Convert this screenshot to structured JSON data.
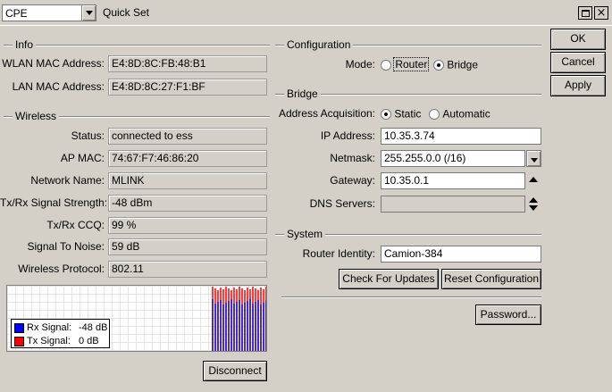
{
  "window": {
    "mode_selector": "CPE",
    "title": "Quick Set",
    "maximize_glyph": "",
    "close_glyph": "×"
  },
  "info": {
    "title": "Info",
    "wlan_mac_label": "WLAN MAC Address:",
    "wlan_mac_value": "E4:8D:8C:FB:48:B1",
    "lan_mac_label": "LAN MAC Address:",
    "lan_mac_value": "E4:8D:8C:27:F1:BF"
  },
  "wireless": {
    "title": "Wireless",
    "rows": [
      {
        "label": "Status:",
        "value": "connected to ess"
      },
      {
        "label": "AP MAC:",
        "value": "74:67:F7:46:86:20"
      },
      {
        "label": "Network Name:",
        "value": "MLINK"
      },
      {
        "label": "Tx/Rx Signal Strength:",
        "value": "-48 dBm"
      },
      {
        "label": "Tx/Rx CCQ:",
        "value": "99 %"
      },
      {
        "label": "Signal To Noise:",
        "value": "59 dB"
      },
      {
        "label": "Wireless Protocol:",
        "value": "802.11"
      }
    ]
  },
  "graph": {
    "legend": [
      {
        "name": "Rx Signal:",
        "value": "-48 dB",
        "color": "#0000ff"
      },
      {
        "name": "Tx Signal:",
        "value": "0 dB",
        "color": "#ff0000"
      }
    ]
  },
  "disconnect_label": "Disconnect",
  "configuration": {
    "title": "Configuration",
    "mode_label": "Mode:",
    "mode_options": [
      "Router",
      "Bridge"
    ],
    "mode_selected": "Bridge"
  },
  "bridge": {
    "title": "Bridge",
    "acq_label": "Address Acquisition:",
    "acq_options": [
      "Static",
      "Automatic"
    ],
    "acq_selected": "Static",
    "ip_label": "IP Address:",
    "ip_value": "10.35.3.74",
    "netmask_label": "Netmask:",
    "netmask_value": "255.255.0.0 (/16)",
    "gateway_label": "Gateway:",
    "gateway_value": "10.35.0.1",
    "dns_label": "DNS Servers:",
    "dns_value": ""
  },
  "system": {
    "title": "System",
    "identity_label": "Router Identity:",
    "identity_value": "Camion-384",
    "check_updates_label": "Check For Updates",
    "reset_config_label": "Reset Configuration"
  },
  "password_label": "Password...",
  "actions": {
    "ok": "OK",
    "cancel": "Cancel",
    "apply": "Apply"
  }
}
